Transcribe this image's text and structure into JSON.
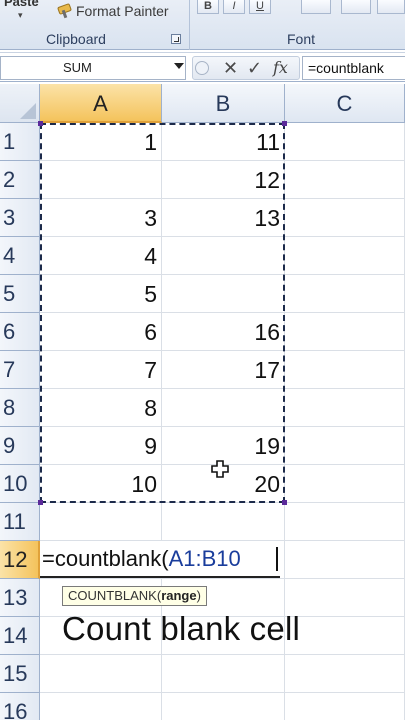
{
  "ribbon": {
    "paste_stub": "Paste",
    "format_painter_label": "Format Painter",
    "clipboard_group_label": "Clipboard",
    "font_group_label": "Font",
    "font_buttons": [
      "B",
      "I",
      "U"
    ]
  },
  "formula_bar": {
    "name_box": "SUM",
    "content": "=countblank"
  },
  "columns": [
    "A",
    "B",
    "C"
  ],
  "rows": [
    {
      "num": "1",
      "a": "1",
      "b": "11"
    },
    {
      "num": "2",
      "a": "",
      "b": "12"
    },
    {
      "num": "3",
      "a": "3",
      "b": "13"
    },
    {
      "num": "4",
      "a": "4",
      "b": ""
    },
    {
      "num": "5",
      "a": "5",
      "b": ""
    },
    {
      "num": "6",
      "a": "6",
      "b": "16"
    },
    {
      "num": "7",
      "a": "7",
      "b": "17"
    },
    {
      "num": "8",
      "a": "8",
      "b": ""
    },
    {
      "num": "9",
      "a": "9",
      "b": "19"
    },
    {
      "num": "10",
      "a": "10",
      "b": "20"
    },
    {
      "num": "11",
      "a": "",
      "b": ""
    },
    {
      "num": "12",
      "a": "",
      "b": ""
    },
    {
      "num": "13",
      "a": "",
      "b": ""
    },
    {
      "num": "14",
      "a": "",
      "b": ""
    },
    {
      "num": "15",
      "a": "",
      "b": ""
    },
    {
      "num": "16",
      "a": "",
      "b": ""
    }
  ],
  "active_row": "12",
  "active_column": "A",
  "editing_cell": {
    "func": "=countblank(",
    "ref": "A1:B10"
  },
  "tooltip": {
    "func": "COUNTBLANK(",
    "arg": "range",
    "close": ")"
  },
  "caption": "Count blank cell",
  "colors": {
    "selection_header": "#f4c35c",
    "range_ref": "#1a3d9c",
    "header_text": "#27395a"
  },
  "icons": [
    "format-painter-icon",
    "dialog-launcher-icon",
    "name-box-dropdown-icon",
    "cancel-x-icon",
    "enter-check-icon",
    "fx-icon",
    "move-cursor-icon"
  ]
}
